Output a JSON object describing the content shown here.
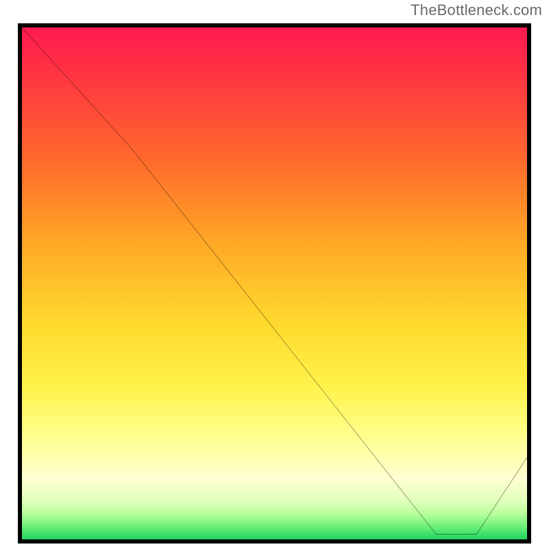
{
  "attribution": "TheBottleneck.com",
  "chart_data": {
    "type": "line",
    "title": "",
    "xlabel": "",
    "ylabel": "",
    "x": [
      0,
      22,
      82,
      90,
      100
    ],
    "values": [
      100,
      76,
      1,
      1,
      16
    ],
    "xlim": [
      0,
      100
    ],
    "ylim": [
      0,
      100
    ],
    "series_color": "#000000",
    "background": "heatmap-gradient",
    "gradient_stops": [
      {
        "pos": 0.0,
        "color": "#ff1a50"
      },
      {
        "pos": 0.12,
        "color": "#ff3d3e"
      },
      {
        "pos": 0.26,
        "color": "#ff6a2c"
      },
      {
        "pos": 0.42,
        "color": "#ffa826"
      },
      {
        "pos": 0.58,
        "color": "#ffda2e"
      },
      {
        "pos": 0.7,
        "color": "#fff24a"
      },
      {
        "pos": 0.8,
        "color": "#ffff8f"
      },
      {
        "pos": 0.88,
        "color": "#ffffd2"
      },
      {
        "pos": 0.92,
        "color": "#e6ffbe"
      },
      {
        "pos": 0.95,
        "color": "#b8ff9c"
      },
      {
        "pos": 0.975,
        "color": "#6cf07a"
      },
      {
        "pos": 1.0,
        "color": "#1fd45e"
      }
    ],
    "baseline_label": "",
    "baseline_label_pos_x": 86
  }
}
